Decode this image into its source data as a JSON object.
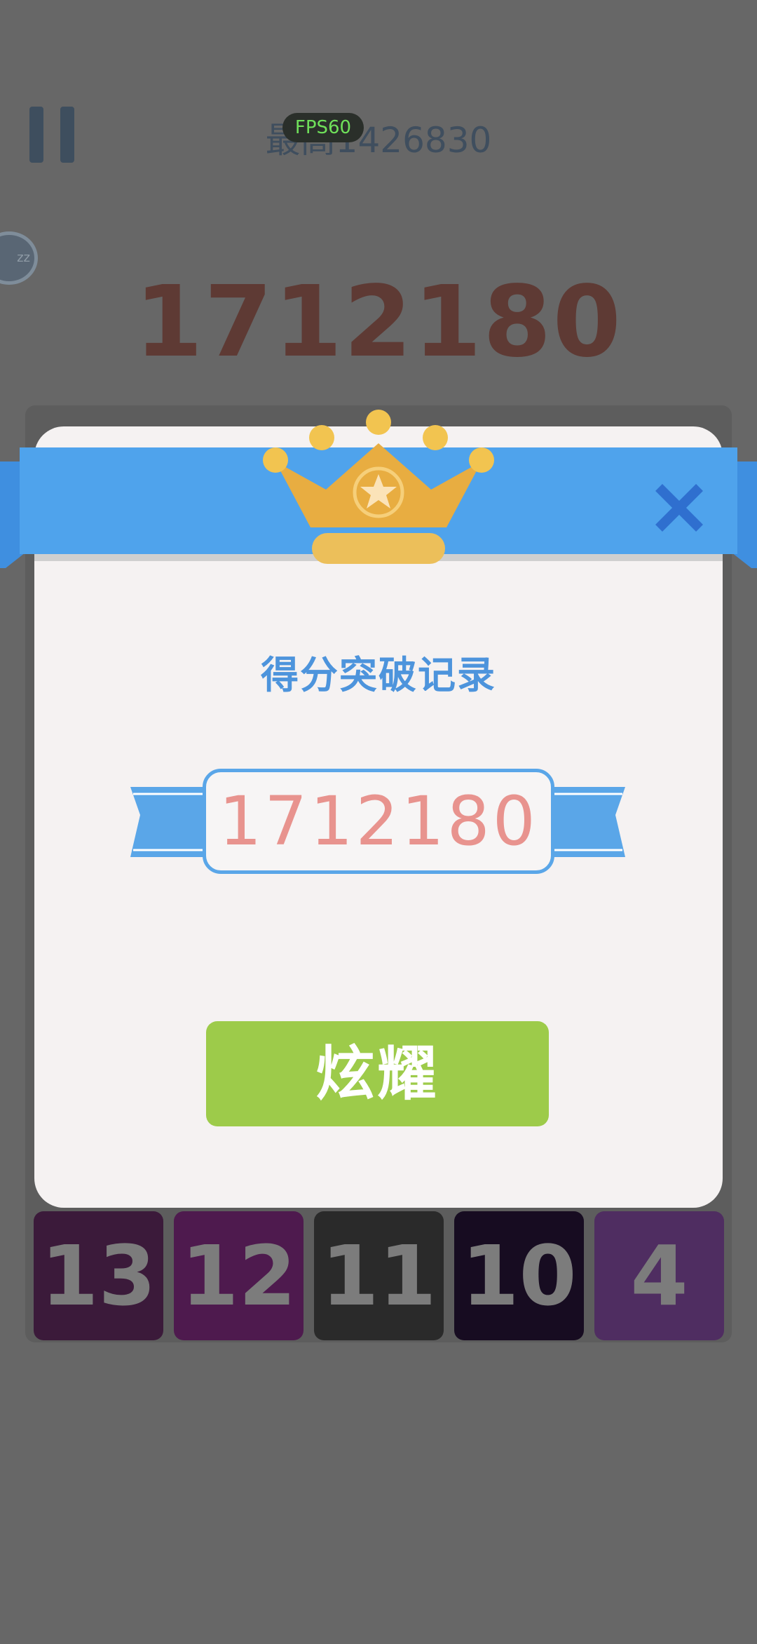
{
  "hud": {
    "best_score": "最高1426830",
    "fps": "FPS60",
    "current_score": "1712180",
    "sleep_icon_label": "zz"
  },
  "bottom_tiles": [
    {
      "value": "13",
      "color": "#3b1a3a"
    },
    {
      "value": "12",
      "color": "#4e1a4e"
    },
    {
      "value": "11",
      "color": "#2a2a2a"
    },
    {
      "value": "10",
      "color": "#170c21"
    },
    {
      "value": "4",
      "color": "#4f2d61"
    }
  ],
  "dialog": {
    "title": "得分突破记录",
    "record_score": "1712180",
    "share_button": "炫耀",
    "icons": {
      "crown": "crown-icon",
      "close": "close-icon",
      "star": "star-icon"
    }
  },
  "colors": {
    "overlay": "#676767",
    "banner": "#4fa3ec",
    "crown": "#e8ad41",
    "button": "#9dcb4a",
    "record_text": "#e8938e",
    "title_text": "#4d94dc"
  }
}
